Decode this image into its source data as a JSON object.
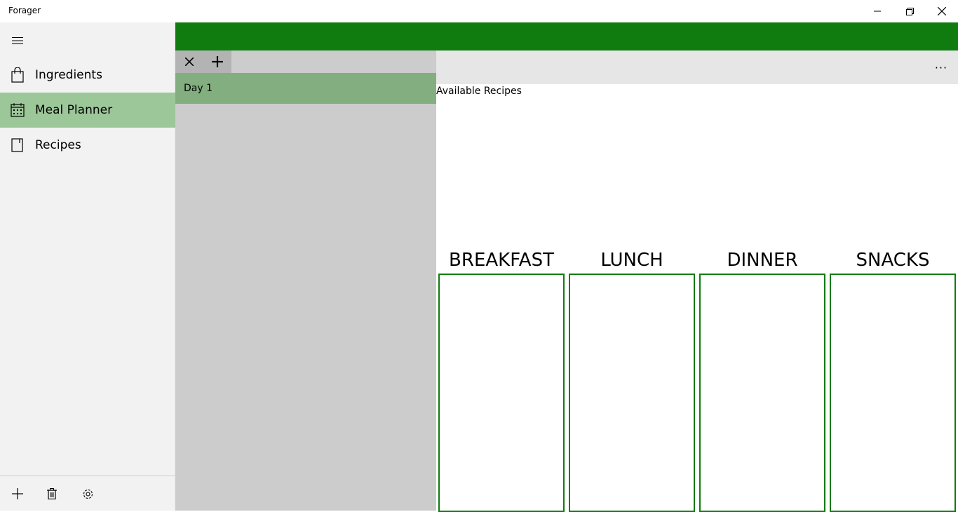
{
  "window": {
    "title": "Forager",
    "controls": {
      "minimize": "minimize-icon",
      "restore": "restore-icon",
      "close": "close-icon"
    }
  },
  "nav": {
    "items": [
      {
        "label": "Ingredients",
        "icon": "shopping-bag-icon",
        "selected": false
      },
      {
        "label": "Meal Planner",
        "icon": "calendar-icon",
        "selected": true
      },
      {
        "label": "Recipes",
        "icon": "book-icon",
        "selected": false
      }
    ],
    "bottom": [
      "add-icon",
      "delete-icon",
      "settings-icon"
    ]
  },
  "days": {
    "items": [
      {
        "label": "Day 1",
        "selected": true
      }
    ]
  },
  "main": {
    "more_label": "···",
    "available_recipes_label": "Available Recipes",
    "meals": [
      "BREAKFAST",
      "LUNCH",
      "DINNER",
      "SNACKS"
    ]
  },
  "colors": {
    "accent": "#107c10",
    "nav_selected": "#9cc799",
    "day_selected": "#83ae80",
    "pane_gray": "#cccccc"
  }
}
